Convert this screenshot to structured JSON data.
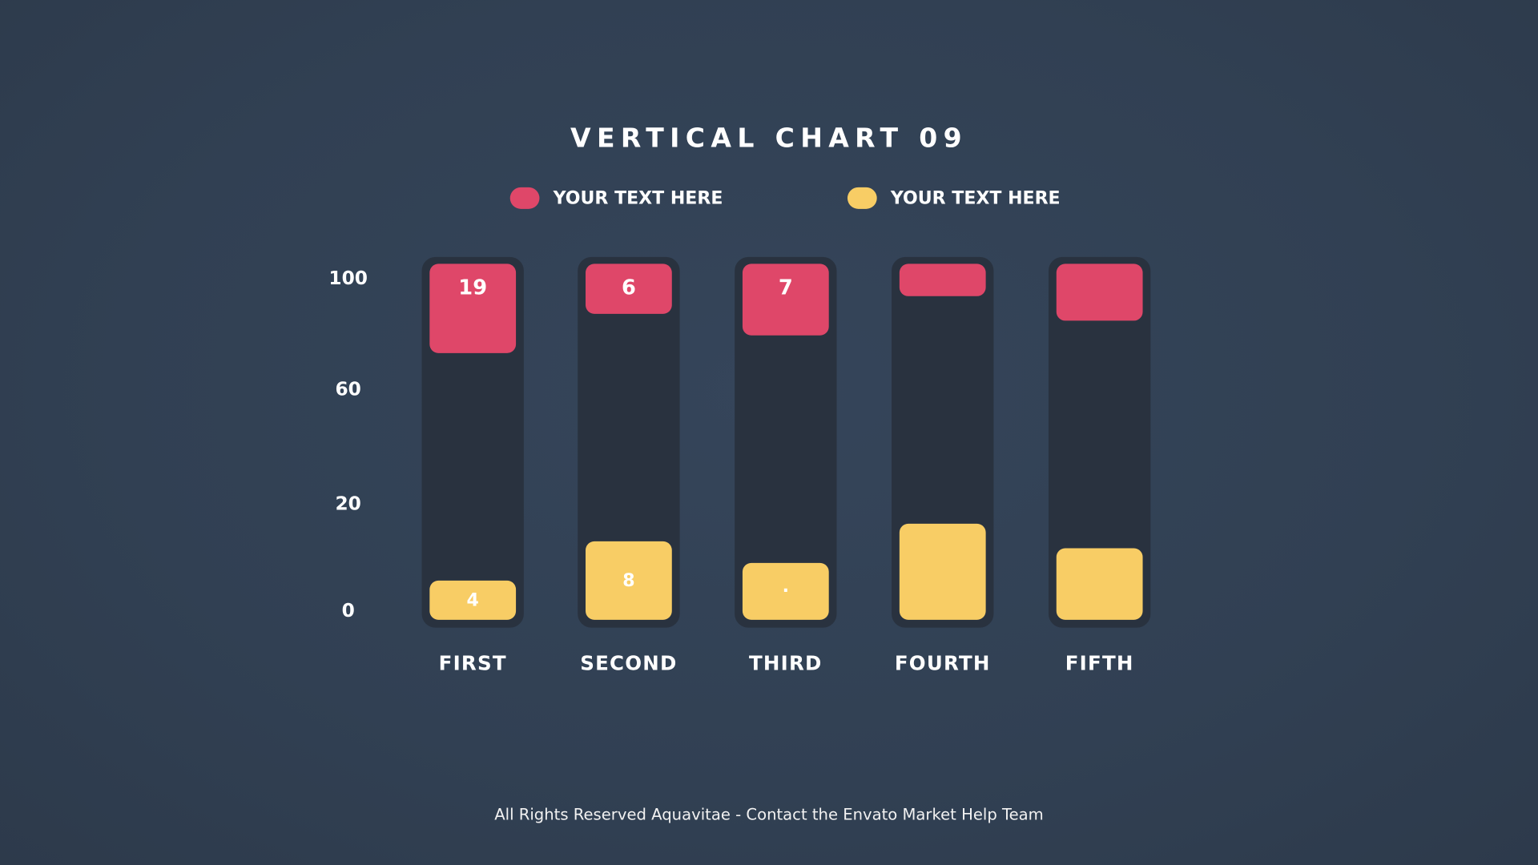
{
  "chart_data": {
    "type": "bar",
    "stacked_style": "top-and-bottom segments in track",
    "title": "VERTICAL CHART 09",
    "categories": [
      "FIRST",
      "SECOND",
      "THIRD",
      "FOURTH",
      "FIFTH"
    ],
    "y_ticks": [
      "100",
      "60",
      "20",
      "0"
    ],
    "ylim": [
      0,
      100
    ],
    "legend_position": "top",
    "series": [
      {
        "name": "YOUR TEXT HERE",
        "color": "#df4769",
        "anchor": "top",
        "values": [
          25,
          14,
          20,
          9,
          16
        ],
        "labels": [
          "19",
          "6",
          "7",
          "",
          ""
        ]
      },
      {
        "name": "YOUR TEXT HERE",
        "color": "#f8cd65",
        "anchor": "bottom",
        "values": [
          11,
          22,
          16,
          27,
          20
        ],
        "labels": [
          "4",
          "8",
          "·",
          "",
          ""
        ]
      }
    ],
    "grid": false
  },
  "footer": "All Rights Reserved Aquavitae - Contact the Envato Market Help Team"
}
